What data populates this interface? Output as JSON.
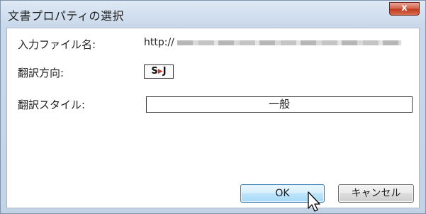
{
  "window": {
    "title": "文書プロパティの選択",
    "close_label": "x"
  },
  "fields": {
    "file_name_label": "入力ファイル名:",
    "file_name_value": "http://",
    "direction_label": "翻訳方向:",
    "direction_source": "S",
    "direction_target": "J",
    "style_label": "翻訳スタイル:",
    "style_value": "一般"
  },
  "buttons": {
    "ok_label": "OK",
    "cancel_label": "キャンセル"
  },
  "icons": {
    "direction_arrow": "right-arrow-icon",
    "cursor": "mouse-pointer-icon"
  },
  "colors": {
    "close_button": "#c0391e",
    "ok_button_border": "#3c7fb1",
    "direction_arrow": "#c0392b"
  }
}
